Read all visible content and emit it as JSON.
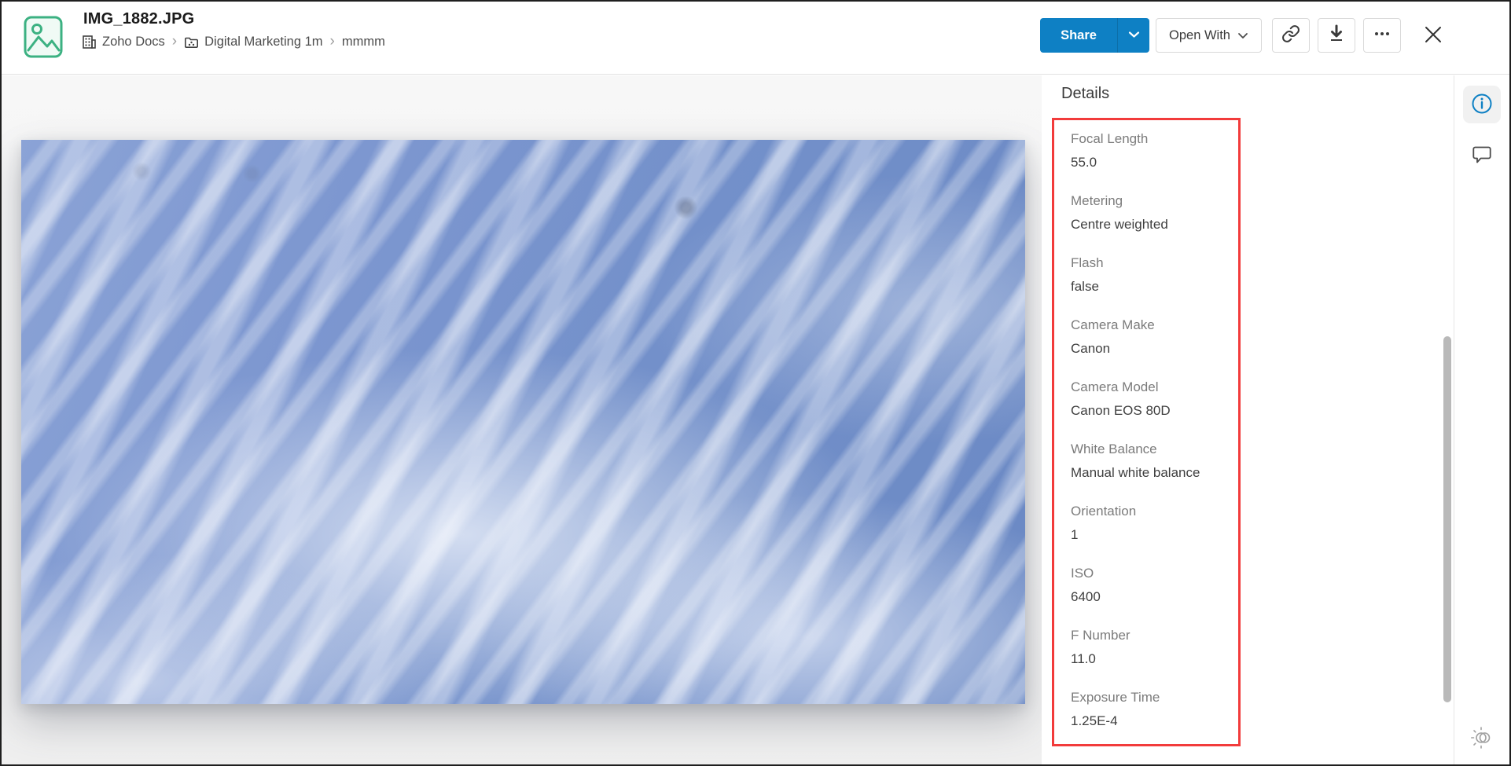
{
  "header": {
    "title": "IMG_1882.JPG",
    "breadcrumb": {
      "separator": "›",
      "items": [
        {
          "label": "Zoho Docs",
          "icon": "building-icon"
        },
        {
          "label": "Digital Marketing 1m",
          "icon": "team-folder-icon"
        },
        {
          "label": "mmmm",
          "icon": ""
        }
      ]
    },
    "actions": {
      "share": "Share",
      "open_with": "Open With",
      "more": "•••"
    }
  },
  "details": {
    "heading": "Details",
    "fields": [
      {
        "label": "Focal Length",
        "value": "55.0"
      },
      {
        "label": "Metering",
        "value": "Centre weighted"
      },
      {
        "label": "Flash",
        "value": "false"
      },
      {
        "label": "Camera Make",
        "value": "Canon"
      },
      {
        "label": "Camera Model",
        "value": "Canon EOS 80D"
      },
      {
        "label": "White Balance",
        "value": "Manual white balance"
      },
      {
        "label": "Orientation",
        "value": "1"
      },
      {
        "label": "ISO",
        "value": "6400"
      },
      {
        "label": "F Number",
        "value": "11.0"
      },
      {
        "label": "Exposure Time",
        "value": "1.25E-4"
      }
    ]
  },
  "colors": {
    "accent_blue": "#0e80c4",
    "highlight_red": "#f23b3b",
    "file_icon_green": "#3cb182"
  },
  "icons": {
    "header_left": [
      "image-file-icon",
      "building-icon",
      "team-folder-icon"
    ],
    "header_right": [
      "chevron-down-icon",
      "copy-link-icon",
      "download-icon",
      "more-icon",
      "close-icon"
    ],
    "rail": [
      "info-icon",
      "comment-icon",
      "theme-toggle-icon"
    ]
  }
}
